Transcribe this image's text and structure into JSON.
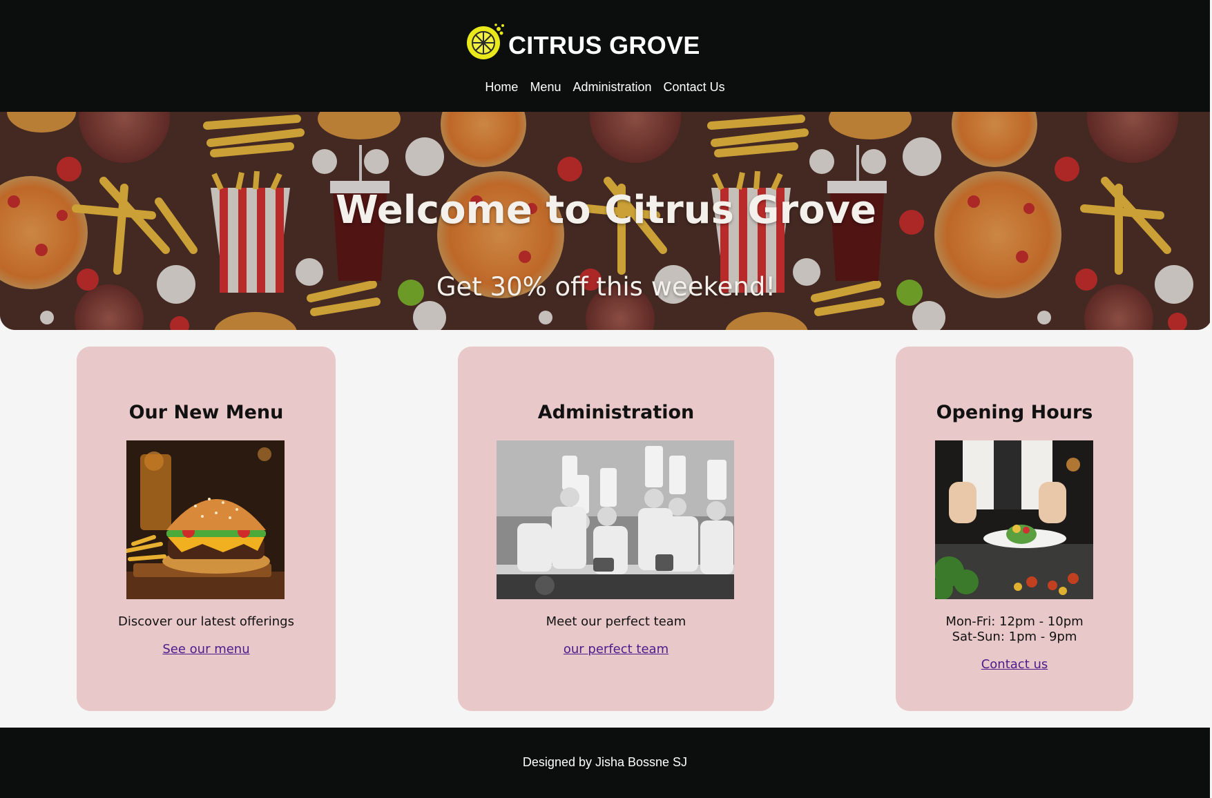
{
  "brand": {
    "name": "CITRUS GROVE",
    "logo_icon": "lemon-slice-icon"
  },
  "nav": {
    "items": [
      "Home",
      "Menu",
      "Administration",
      "Contact Us"
    ]
  },
  "hero": {
    "title": "Welcome to Citrus Grove",
    "subtitle": "Get 30% off this weekend!",
    "background": "fast-food-pattern"
  },
  "cards": [
    {
      "title": "Our New Menu",
      "image": "burger-photo",
      "description": "Discover our latest offerings",
      "link": "See our menu"
    },
    {
      "title": "Administration",
      "image": "chefs-team-photo",
      "description": "Meet our perfect team",
      "link": "our perfect team"
    },
    {
      "title": "Opening Hours",
      "image": "chef-plating-photo",
      "hours": [
        "Mon-Fri: 12pm - 10pm",
        "Sat-Sun: 1pm - 9pm"
      ],
      "link": "Contact us"
    }
  ],
  "footer": {
    "credit": "Designed by Jisha Bossne SJ"
  },
  "colors": {
    "header_bg": "#0c0e0e",
    "card_bg": "#e8c8c9",
    "link": "#4b1b8c",
    "page_bg": "#f5f5f5"
  }
}
